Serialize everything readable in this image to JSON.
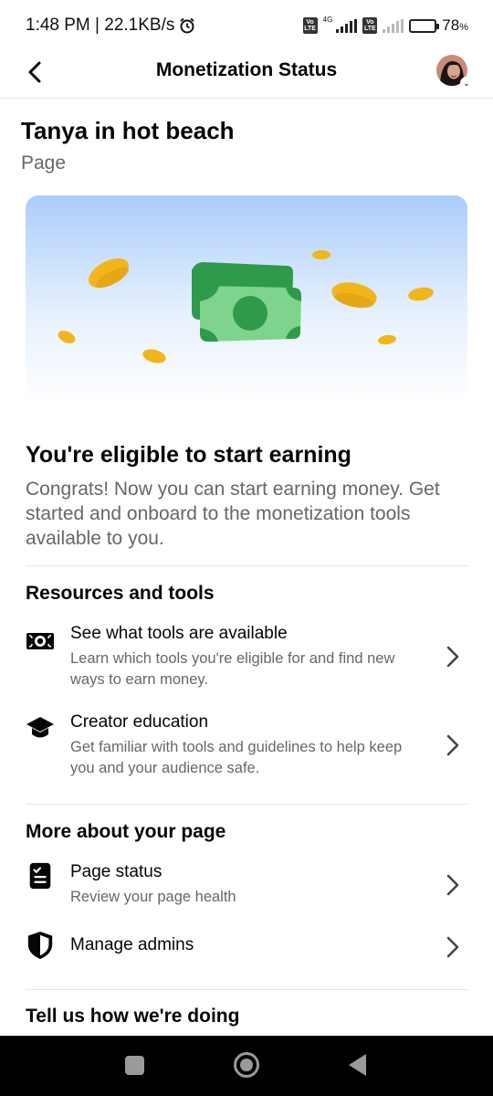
{
  "status_bar": {
    "time_speed": "1:48 PM | 22.1KB/s",
    "volte": "Vo LTE",
    "network_type": "4G",
    "battery": "78",
    "battery_unit": "%",
    "battery_level": 0.78
  },
  "header": {
    "title": "Monetization Status",
    "avatar_chevron": "⌄"
  },
  "page": {
    "name": "Tanya in hot beach",
    "type": "Page"
  },
  "eligibility": {
    "title": "You're eligible to start earning",
    "text": "Congrats! Now you can start earning money. Get started and onboard to the monetization tools available to you."
  },
  "resources": {
    "title": "Resources and tools",
    "items": [
      {
        "title": "See what tools are available",
        "subtitle": "Learn which tools you're eligible for and find new ways to earn money.",
        "icon": "money-icon"
      },
      {
        "title": "Creator education",
        "subtitle": "Get familiar with tools and guidelines to help keep you and your audience safe.",
        "icon": "graduation-cap-icon"
      }
    ]
  },
  "more_about": {
    "title": "More about your page",
    "items": [
      {
        "title": "Page status",
        "subtitle": "Review your page health",
        "icon": "clipboard-checklist-icon"
      },
      {
        "title": "Manage admins",
        "icon": "shield-icon"
      }
    ]
  },
  "feedback": {
    "title": "Tell us how we're doing"
  },
  "colors": {
    "money_green": "#3fb25a",
    "coin_gold": "#f2b51b",
    "hero_sky": "#a9cdfb",
    "secondary_text": "#65676b"
  }
}
